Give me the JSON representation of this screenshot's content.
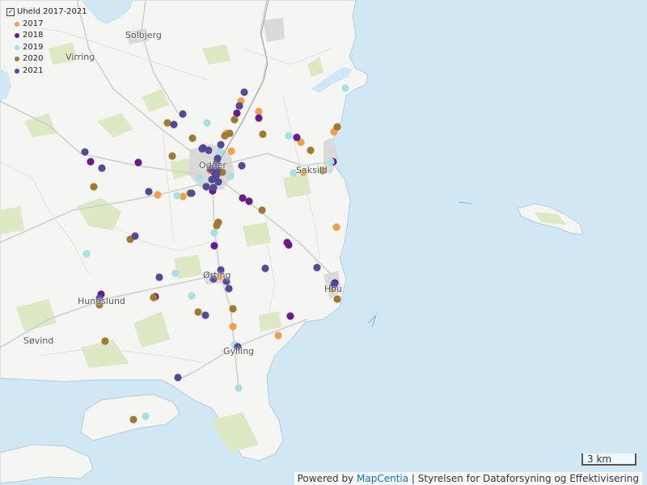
{
  "legend": {
    "title": "Uheld 2017-2021",
    "items": [
      {
        "label": "2017",
        "color": "#f0a04b"
      },
      {
        "label": "2018",
        "color": "#6a1b8a"
      },
      {
        "label": "2019",
        "color": "#a8e0e3"
      },
      {
        "label": "2020",
        "color": "#a07a30"
      },
      {
        "label": "2021",
        "color": "#524a94"
      }
    ]
  },
  "places": [
    {
      "key": "solbjerg",
      "name": "Solbjerg"
    },
    {
      "key": "virring",
      "name": "Virring"
    },
    {
      "key": "odder",
      "name": "Odder"
    },
    {
      "key": "saksild",
      "name": "Saksild"
    },
    {
      "key": "orting",
      "name": "Ørting"
    },
    {
      "key": "hou",
      "name": "Hou"
    },
    {
      "key": "hundslund",
      "name": "Hundslund"
    },
    {
      "key": "sovind",
      "name": "Søvind"
    },
    {
      "key": "gylling",
      "name": "Gylling"
    }
  ],
  "scale_label": "3 km",
  "attribution": {
    "prefix": "Powered by",
    "link": "MapCentia",
    "suffix": "| Styrelsen for Dataforsyning og Effektivisering"
  },
  "accidents": [
    {
      "year": "2017",
      "pts": [
        [
          298,
          125
        ],
        [
          320,
          138
        ],
        [
          280,
          165
        ],
        [
          286,
          187
        ],
        [
          372,
          176
        ],
        [
          375,
          213
        ],
        [
          413,
          163
        ],
        [
          195,
          241
        ],
        [
          226,
          243
        ],
        [
          272,
          342
        ],
        [
          288,
          404
        ],
        [
          344,
          415
        ],
        [
          416,
          281
        ]
      ]
    },
    {
      "year": "2018",
      "pts": [
        [
          293,
          140
        ],
        [
          320,
          146
        ],
        [
          367,
          170
        ],
        [
          251,
          183
        ],
        [
          112,
          200
        ],
        [
          171,
          201
        ],
        [
          264,
          212
        ],
        [
          267,
          217
        ],
        [
          263,
          236
        ],
        [
          300,
          245
        ],
        [
          308,
          249
        ],
        [
          355,
          300
        ],
        [
          357,
          303
        ],
        [
          265,
          304
        ],
        [
          125,
          364
        ],
        [
          192,
          367
        ],
        [
          414,
          350
        ],
        [
          359,
          391
        ],
        [
          412,
          200
        ]
      ]
    },
    {
      "year": "2019",
      "pts": [
        [
          427,
          109
        ],
        [
          256,
          152
        ],
        [
          357,
          168
        ],
        [
          272,
          187
        ],
        [
          246,
          220
        ],
        [
          285,
          218
        ],
        [
          363,
          214
        ],
        [
          219,
          242
        ],
        [
          265,
          288
        ],
        [
          107,
          314
        ],
        [
          217,
          338
        ],
        [
          237,
          366
        ],
        [
          290,
          426
        ],
        [
          295,
          480
        ],
        [
          180,
          515
        ],
        [
          409,
          200
        ]
      ]
    },
    {
      "year": "2020",
      "pts": [
        [
          290,
          148
        ],
        [
          207,
          152
        ],
        [
          278,
          168
        ],
        [
          284,
          165
        ],
        [
          238,
          171
        ],
        [
          325,
          166
        ],
        [
          384,
          186
        ],
        [
          213,
          193
        ],
        [
          268,
          203
        ],
        [
          275,
          213
        ],
        [
          260,
          210
        ],
        [
          417,
          157
        ],
        [
          399,
          211
        ],
        [
          116,
          231
        ],
        [
          235,
          239
        ],
        [
          324,
          260
        ],
        [
          268,
          279
        ],
        [
          270,
          275
        ],
        [
          161,
          296
        ],
        [
          411,
          357
        ],
        [
          417,
          370
        ],
        [
          123,
          377
        ],
        [
          190,
          368
        ],
        [
          245,
          386
        ],
        [
          288,
          382
        ],
        [
          130,
          422
        ],
        [
          165,
          519
        ]
      ]
    },
    {
      "year": "2021",
      "pts": [
        [
          302,
          114
        ],
        [
          296,
          131
        ],
        [
          226,
          141
        ],
        [
          215,
          154
        ],
        [
          273,
          179
        ],
        [
          250,
          184
        ],
        [
          258,
          186
        ],
        [
          105,
          188
        ],
        [
          269,
          196
        ],
        [
          268,
          202
        ],
        [
          299,
          205
        ],
        [
          261,
          208
        ],
        [
          269,
          210
        ],
        [
          268,
          216
        ],
        [
          262,
          222
        ],
        [
          270,
          225
        ],
        [
          255,
          231
        ],
        [
          264,
          232
        ],
        [
          237,
          239
        ],
        [
          184,
          237
        ],
        [
          126,
          208
        ],
        [
          167,
          292
        ],
        [
          273,
          334
        ],
        [
          264,
          345
        ],
        [
          280,
          348
        ],
        [
          283,
          357
        ],
        [
          197,
          343
        ],
        [
          328,
          332
        ],
        [
          392,
          331
        ],
        [
          254,
          390
        ],
        [
          294,
          429
        ],
        [
          220,
          467
        ],
        [
          413,
          352
        ],
        [
          123,
          369
        ]
      ]
    }
  ]
}
